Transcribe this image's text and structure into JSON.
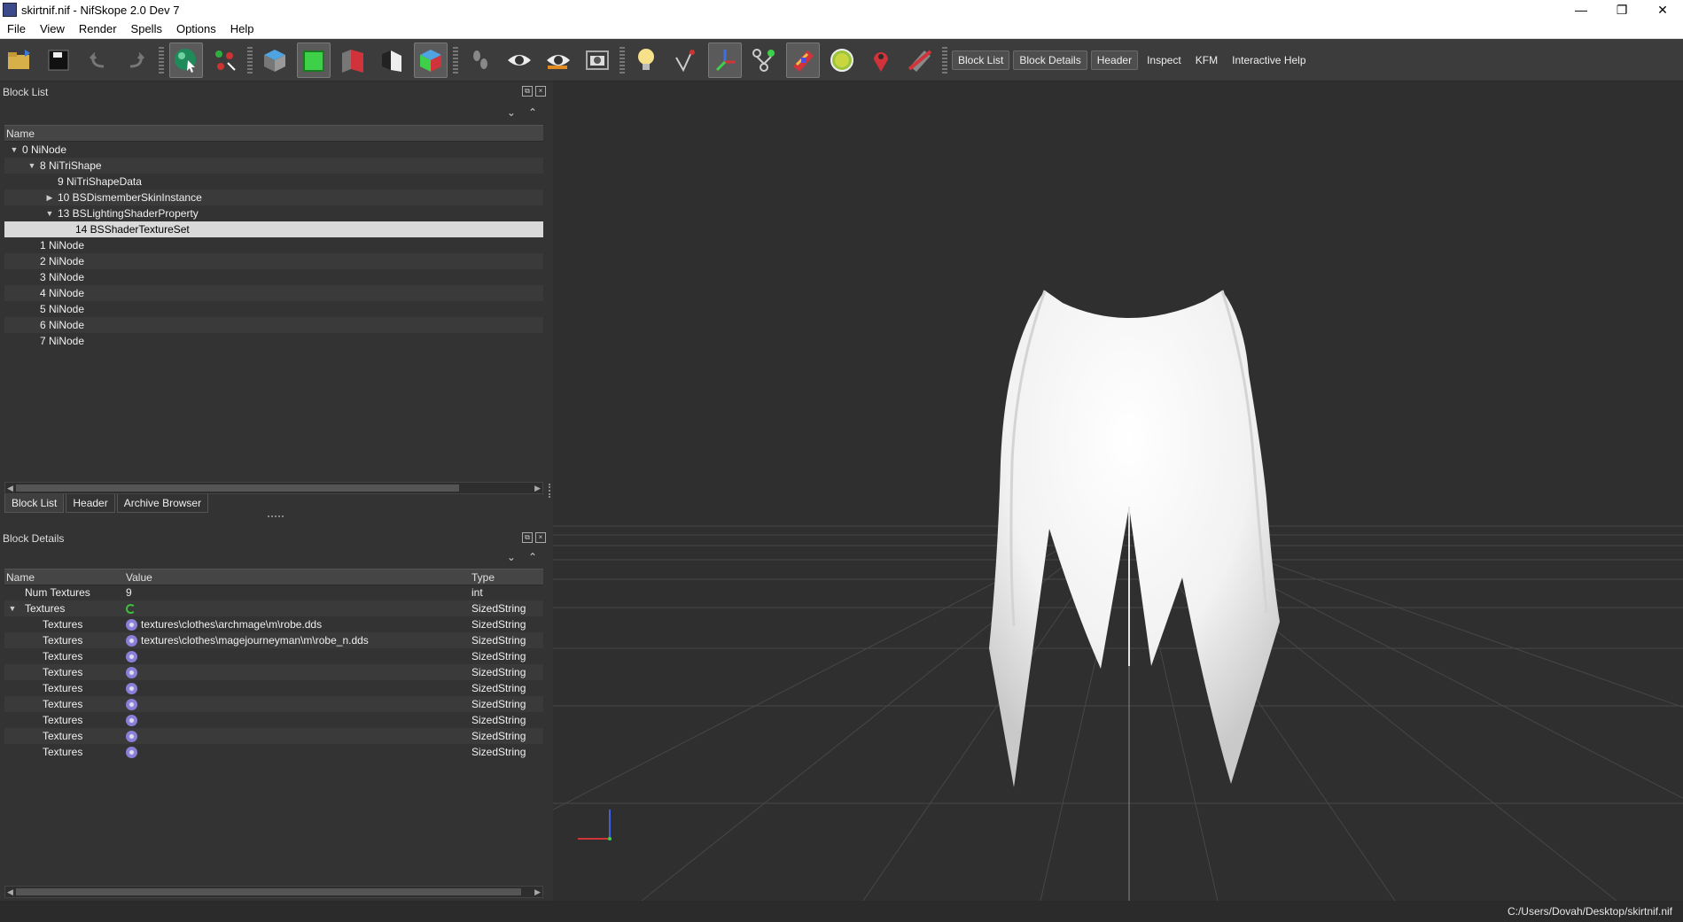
{
  "window": {
    "title": "skirtnif.nif - NifSkope 2.0 Dev 7",
    "minimize": "—",
    "restore": "❐",
    "close": "✕"
  },
  "menu": [
    "File",
    "View",
    "Render",
    "Spells",
    "Options",
    "Help"
  ],
  "toolbar": {
    "text_buttons": [
      "Block List",
      "Block Details",
      "Header",
      "Inspect",
      "KFM",
      "Interactive Help"
    ]
  },
  "block_list": {
    "title": "Block List",
    "column": "Name",
    "rows": [
      {
        "label": "0 NiNode",
        "indent": 0,
        "toggle": "▼"
      },
      {
        "label": "8 NiTriShape",
        "indent": 1,
        "toggle": "▼"
      },
      {
        "label": "9 NiTriShapeData",
        "indent": 2,
        "toggle": ""
      },
      {
        "label": "10 BSDismemberSkinInstance",
        "indent": 2,
        "toggle": "▶"
      },
      {
        "label": "13 BSLightingShaderProperty",
        "indent": 2,
        "toggle": "▼"
      },
      {
        "label": "14 BSShaderTextureSet",
        "indent": 3,
        "toggle": ""
      },
      {
        "label": "1 NiNode",
        "indent": 1,
        "toggle": ""
      },
      {
        "label": "2 NiNode",
        "indent": 1,
        "toggle": ""
      },
      {
        "label": "3 NiNode",
        "indent": 1,
        "toggle": ""
      },
      {
        "label": "4 NiNode",
        "indent": 1,
        "toggle": ""
      },
      {
        "label": "5 NiNode",
        "indent": 1,
        "toggle": ""
      },
      {
        "label": "6 NiNode",
        "indent": 1,
        "toggle": ""
      },
      {
        "label": "7 NiNode",
        "indent": 1,
        "toggle": ""
      }
    ],
    "tabs": [
      "Block List",
      "Header",
      "Archive Browser"
    ]
  },
  "block_details": {
    "title": "Block Details",
    "columns": [
      "Name",
      "Value",
      "Type"
    ],
    "rows": [
      {
        "name": "Num Textures",
        "value": "9",
        "type": "int",
        "toggle": "",
        "icon": "none"
      },
      {
        "name": "Textures",
        "value": "",
        "type": "SizedString",
        "toggle": "▼",
        "icon": "refresh"
      },
      {
        "name": "Textures",
        "value": "textures\\clothes\\archmage\\m\\robe.dds",
        "type": "SizedString",
        "toggle": "",
        "icon": "gear"
      },
      {
        "name": "Textures",
        "value": "textures\\clothes\\magejourneyman\\m\\robe_n.dds",
        "type": "SizedString",
        "toggle": "",
        "icon": "gear"
      },
      {
        "name": "Textures",
        "value": "",
        "type": "SizedString",
        "toggle": "",
        "icon": "gear"
      },
      {
        "name": "Textures",
        "value": "",
        "type": "SizedString",
        "toggle": "",
        "icon": "gear"
      },
      {
        "name": "Textures",
        "value": "",
        "type": "SizedString",
        "toggle": "",
        "icon": "gear"
      },
      {
        "name": "Textures",
        "value": "",
        "type": "SizedString",
        "toggle": "",
        "icon": "gear"
      },
      {
        "name": "Textures",
        "value": "",
        "type": "SizedString",
        "toggle": "",
        "icon": "gear"
      },
      {
        "name": "Textures",
        "value": "",
        "type": "SizedString",
        "toggle": "",
        "icon": "gear"
      },
      {
        "name": "Textures",
        "value": "",
        "type": "SizedString",
        "toggle": "",
        "icon": "gear"
      }
    ]
  },
  "status": {
    "path": "C:/Users/Dovah/Desktop/skirtnif.nif"
  }
}
